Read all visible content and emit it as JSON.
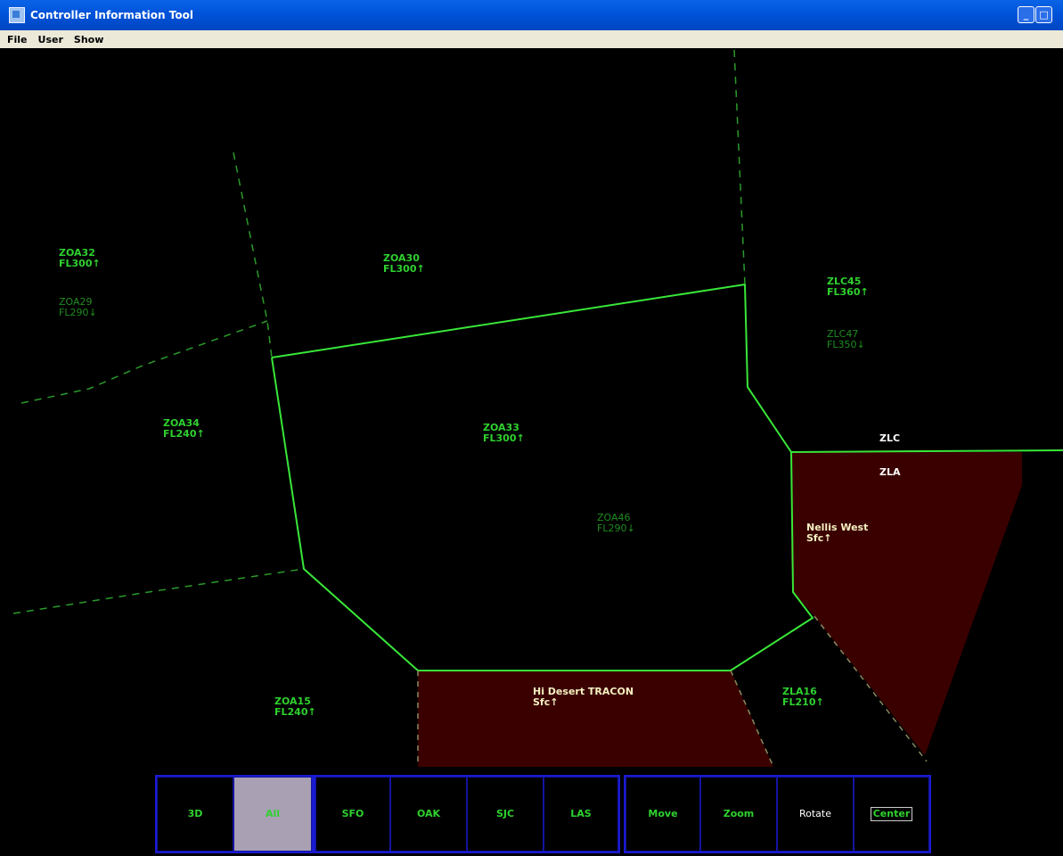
{
  "window": {
    "title": "Controller Information Tool"
  },
  "menu": {
    "items": [
      "File",
      "User",
      "Show"
    ]
  },
  "sectors": {
    "zoa32": {
      "name": "ZOA32",
      "alt": "FL300↑"
    },
    "zoa29": {
      "name": "ZOA29",
      "alt": "FL290↓"
    },
    "zoa30": {
      "name": "ZOA30",
      "alt": "FL300↑"
    },
    "zlc45": {
      "name": "ZLC45",
      "alt": "FL360↑"
    },
    "zlc47": {
      "name": "ZLC47",
      "alt": "FL350↓"
    },
    "zoa34": {
      "name": "ZOA34",
      "alt": "FL240↑"
    },
    "zoa33": {
      "name": "ZOA33",
      "alt": "FL300↑"
    },
    "zoa46": {
      "name": "ZOA46",
      "alt": "FL290↓"
    },
    "zoa15": {
      "name": "ZOA15",
      "alt": "FL240↑"
    },
    "zla16": {
      "name": "ZLA16",
      "alt": "FL210↑"
    },
    "hi_desert": {
      "name": "Hi Desert TRACON",
      "alt": "Sfc↑"
    },
    "nellis_west": {
      "name": "Nellis West",
      "alt": "Sfc↑"
    }
  },
  "boundary_labels": {
    "zlc": "ZLC",
    "zla": "ZLA"
  },
  "toolbar": {
    "btn_3d": "3D",
    "btn_all_2": "All",
    "btn_all_line": "",
    "btn_sfo": "SFO",
    "btn_oak": "OAK",
    "btn_sjc": "SJC",
    "btn_las": "LAS",
    "btn_move": "Move",
    "btn_zoom": "Zoom",
    "btn_rotate": "Rotate",
    "btn_center": "Center"
  },
  "colors": {
    "sector_line": "#39e639",
    "restricted_fill": "#3a0000",
    "toolbar_border": "#1a1ad0",
    "selected_button": "#a9a0b4"
  }
}
